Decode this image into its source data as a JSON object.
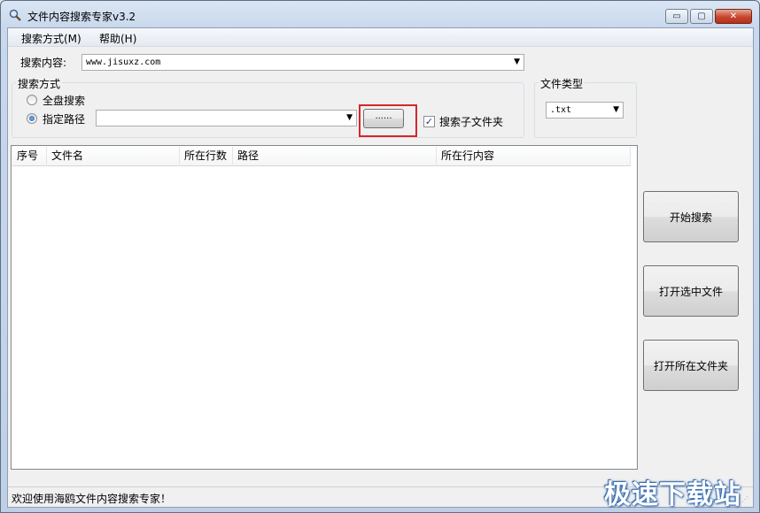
{
  "window": {
    "title": "文件内容搜索专家v3.2",
    "controls": {
      "minimize": "▭",
      "maximize": "▢",
      "close": "✕"
    }
  },
  "menu": {
    "items": [
      "搜索方式(M)",
      "帮助(H)"
    ]
  },
  "search": {
    "label": "搜索内容:",
    "value": "www.jisuxz.com"
  },
  "search_mode": {
    "title": "搜索方式",
    "options": [
      "全盘搜索",
      "指定路径"
    ],
    "selected": "指定路径",
    "path_value": "",
    "browse_label": "······",
    "include_subfolders_label": "搜索子文件夹",
    "include_subfolders_checked": true
  },
  "file_type": {
    "title": "文件类型",
    "value": ".txt"
  },
  "results": {
    "columns": [
      "序号",
      "文件名",
      "所在行数",
      "路径",
      "所在行内容"
    ],
    "rows": []
  },
  "actions": {
    "start": "开始搜索",
    "open_selected": "打开选中文件",
    "open_folder": "打开所在文件夹"
  },
  "status": {
    "text": "欢迎使用海鸥文件内容搜索专家！"
  },
  "watermark": {
    "text": "极速下载站"
  }
}
